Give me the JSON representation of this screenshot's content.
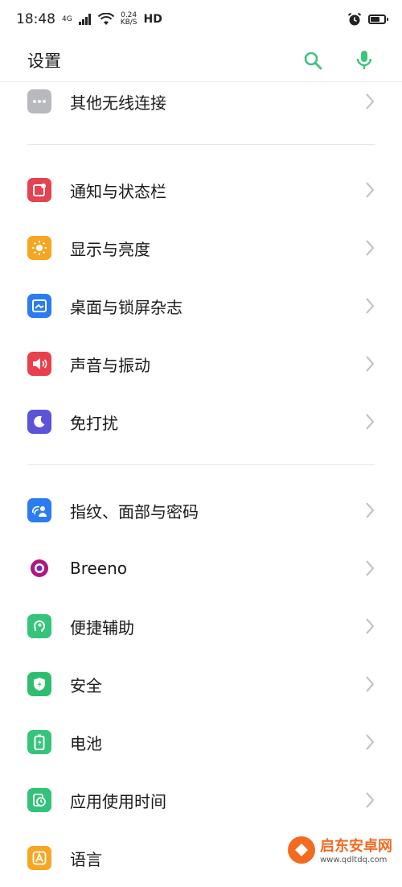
{
  "status_bar": {
    "time": "18:48",
    "network": "4G",
    "speed_value": "0.24",
    "speed_unit": "KB/S",
    "hd": "HD"
  },
  "header": {
    "title": "设置"
  },
  "colors": {
    "accent": "#3fc37a",
    "chevron": "#c4c4c4"
  },
  "sections": {
    "s0": [
      {
        "label": "其他无线连接",
        "icon": "more-dots-icon",
        "color": "#b7b9be"
      }
    ],
    "s1": [
      {
        "label": "通知与状态栏",
        "icon": "notification-icon",
        "color": "#e44352"
      },
      {
        "label": "显示与亮度",
        "icon": "brightness-icon",
        "color": "#f5a623"
      },
      {
        "label": "桌面与锁屏杂志",
        "icon": "wallpaper-icon",
        "color": "#2b7cf0"
      },
      {
        "label": "声音与振动",
        "icon": "speaker-icon",
        "color": "#e8404c"
      },
      {
        "label": "免打扰",
        "icon": "moon-icon",
        "color": "#5b54d6"
      }
    ],
    "s2": [
      {
        "label": "指纹、面部与密码",
        "icon": "fingerprint-face-icon",
        "color": "#2b7cf0"
      },
      {
        "label": "Breeno",
        "icon": "breeno-icon",
        "color": "#b0167f"
      },
      {
        "label": "便捷辅助",
        "icon": "assist-icon",
        "color": "#34c57a"
      },
      {
        "label": "安全",
        "icon": "shield-icon",
        "color": "#2fbe6f"
      },
      {
        "label": "电池",
        "icon": "battery-icon",
        "color": "#35c47b"
      },
      {
        "label": "应用使用时间",
        "icon": "app-time-icon",
        "color": "#33c27a"
      },
      {
        "label": "语言",
        "icon": "language-icon",
        "color": "#f5a623"
      }
    ]
  },
  "watermark": {
    "name": "启东安卓网",
    "url": "www.qdltdq.com"
  }
}
